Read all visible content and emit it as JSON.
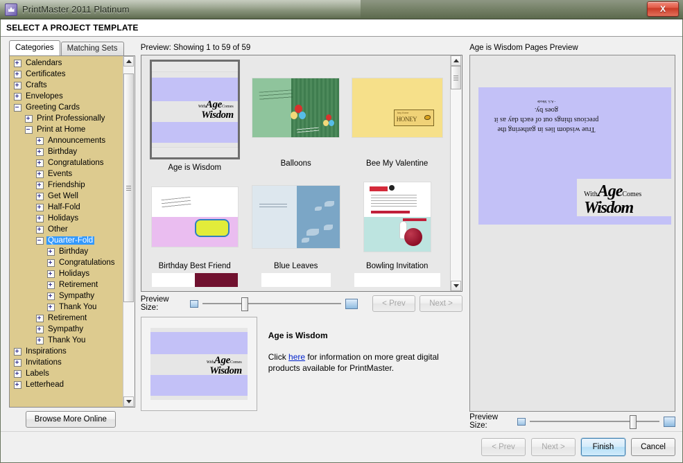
{
  "window": {
    "title": "PrintMaster 2011 Platinum",
    "app_icon": "crown-icon",
    "close_label": "X"
  },
  "banner": {
    "title": "SELECT A PROJECT TEMPLATE"
  },
  "tabs": [
    {
      "label": "Categories",
      "active": true
    },
    {
      "label": "Matching Sets",
      "active": false
    }
  ],
  "tree": {
    "items": [
      {
        "label": "Calendars",
        "depth": 0,
        "state": "plus"
      },
      {
        "label": "Certificates",
        "depth": 0,
        "state": "plus"
      },
      {
        "label": "Crafts",
        "depth": 0,
        "state": "plus"
      },
      {
        "label": "Envelopes",
        "depth": 0,
        "state": "plus"
      },
      {
        "label": "Greeting Cards",
        "depth": 0,
        "state": "minus"
      },
      {
        "label": "Print Professionally",
        "depth": 1,
        "state": "plus"
      },
      {
        "label": "Print at Home",
        "depth": 1,
        "state": "minus"
      },
      {
        "label": "Announcements",
        "depth": 2,
        "state": "plus"
      },
      {
        "label": "Birthday",
        "depth": 2,
        "state": "plus"
      },
      {
        "label": "Congratulations",
        "depth": 2,
        "state": "plus"
      },
      {
        "label": "Events",
        "depth": 2,
        "state": "plus"
      },
      {
        "label": "Friendship",
        "depth": 2,
        "state": "plus"
      },
      {
        "label": "Get Well",
        "depth": 2,
        "state": "plus"
      },
      {
        "label": "Half-Fold",
        "depth": 2,
        "state": "plus"
      },
      {
        "label": "Holidays",
        "depth": 2,
        "state": "plus"
      },
      {
        "label": "Other",
        "depth": 2,
        "state": "plus"
      },
      {
        "label": "Quarter-Fold",
        "depth": 2,
        "state": "minus",
        "selected": true
      },
      {
        "label": "Birthday",
        "depth": 3,
        "state": "plus"
      },
      {
        "label": "Congratulations",
        "depth": 3,
        "state": "plus"
      },
      {
        "label": "Holidays",
        "depth": 3,
        "state": "plus"
      },
      {
        "label": "Retirement",
        "depth": 3,
        "state": "plus"
      },
      {
        "label": "Sympathy",
        "depth": 3,
        "state": "plus"
      },
      {
        "label": "Thank You",
        "depth": 3,
        "state": "plus"
      },
      {
        "label": "Retirement",
        "depth": 2,
        "state": "plus"
      },
      {
        "label": "Sympathy",
        "depth": 2,
        "state": "plus"
      },
      {
        "label": "Thank You",
        "depth": 2,
        "state": "plus"
      },
      {
        "label": "Inspirations",
        "depth": 0,
        "state": "plus"
      },
      {
        "label": "Invitations",
        "depth": 0,
        "state": "plus"
      },
      {
        "label": "Labels",
        "depth": 0,
        "state": "plus"
      },
      {
        "label": "Letterhead",
        "depth": 0,
        "state": "plus"
      }
    ],
    "selection_color": "#3399ff",
    "background_color": "#ddcb8f"
  },
  "browse_button": {
    "label": "Browse More Online"
  },
  "gallery": {
    "header": "Preview: Showing 1 to 59 of 59",
    "items": [
      {
        "name": "Age is Wisdom",
        "selected": true
      },
      {
        "name": "Balloons",
        "selected": false
      },
      {
        "name": "Bee My Valentine",
        "selected": false
      },
      {
        "name": "Birthday Best Friend",
        "selected": false
      },
      {
        "name": "Blue Leaves",
        "selected": false
      },
      {
        "name": "Bowling Invitation",
        "selected": false
      }
    ]
  },
  "preview_size": {
    "label": "Preview Size:",
    "small_icon": "small-square-icon",
    "large_icon": "large-square-icon",
    "center_value": 28,
    "right_value": 72
  },
  "nav": {
    "prev_label": "< Prev",
    "next_label": "Next >"
  },
  "detail": {
    "title": "Age is Wisdom",
    "text_before": "Click ",
    "link": "here",
    "text_after": " for information on more great digital products available for PrintMaster."
  },
  "pages_preview": {
    "header": "Age is Wisdom Pages Preview",
    "verse": "True wisdom lies in gathering the precious things out of each day as it goes by.",
    "attribution": "- A.S. Meade",
    "cover": {
      "with": "With",
      "age": "Age",
      "comes": "Comes",
      "wisdom": "Wisdom"
    }
  },
  "card_art": {
    "wisdom": {
      "with": "With",
      "age": "Age",
      "comes": "Comes",
      "wisdom": "Wisdom"
    },
    "bee": {
      "hay": "hey there",
      "honey": "HONEY"
    }
  },
  "footer": {
    "prev_label": "< Prev",
    "next_label": "Next >",
    "finish_label": "Finish",
    "cancel_label": "Cancel"
  }
}
